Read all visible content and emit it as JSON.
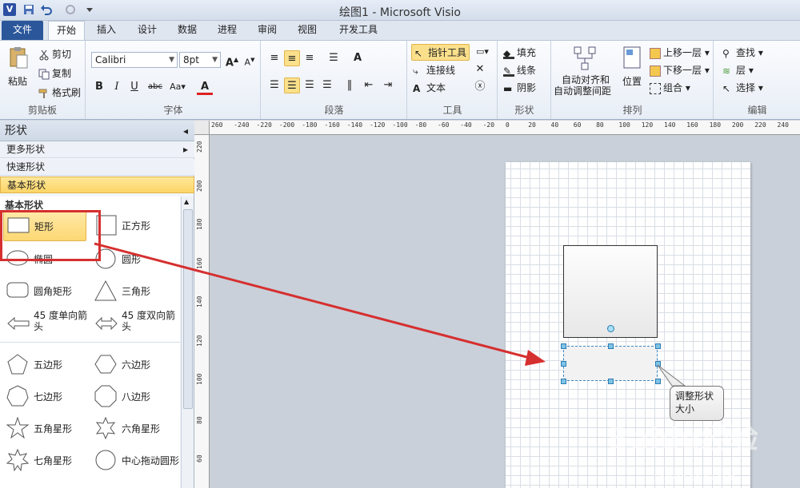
{
  "window": {
    "title": "绘图1 - Microsoft Visio"
  },
  "tabs": [
    "文件",
    "开始",
    "插入",
    "设计",
    "数据",
    "进程",
    "审阅",
    "视图",
    "开发工具"
  ],
  "ribbon": {
    "clipboard": {
      "paste": "粘贴",
      "cut": "剪切",
      "copy": "复制",
      "format_painter": "格式刷",
      "label": "剪贴板"
    },
    "font": {
      "family": "Calibri",
      "size": "8pt",
      "label": "字体"
    },
    "paragraph": {
      "label": "段落"
    },
    "tools": {
      "pointer": "指针工具",
      "connector": "连接线",
      "text": "文本",
      "label": "工具"
    },
    "shape": {
      "fill": "填充",
      "line": "线条",
      "shadow": "阴影",
      "label": "形状"
    },
    "arrange": {
      "auto_align": "自动对齐和\n自动调整间距",
      "auto_align_l1": "自动对齐和",
      "auto_align_l2": "自动调整间距",
      "position": "位置",
      "bring_forward": "上移一层",
      "send_backward": "下移一层",
      "group": "组合",
      "label": "排列"
    },
    "editing": {
      "find": "查找",
      "layer": "层",
      "select": "选择",
      "label": "编辑"
    }
  },
  "shapes_panel": {
    "title": "形状",
    "more_shapes": "更多形状",
    "quick_shapes": "快速形状",
    "basic_shapes": "基本形状",
    "stencil_title": "基本形状",
    "masters": [
      {
        "name": "矩形"
      },
      {
        "name": "正方形"
      },
      {
        "name": "椭圆"
      },
      {
        "name": "圆形"
      },
      {
        "name": "圆角矩形"
      },
      {
        "name": "三角形"
      },
      {
        "name": "45 度单向箭头"
      },
      {
        "name": "45 度双向箭头"
      },
      {
        "name": "五边形"
      },
      {
        "name": "六边形"
      },
      {
        "name": "七边形"
      },
      {
        "name": "八边形"
      },
      {
        "name": "五角星形"
      },
      {
        "name": "六角星形"
      },
      {
        "name": "七角星形"
      },
      {
        "name": "中心拖动圆形"
      }
    ]
  },
  "ruler": {
    "h_ticks": [
      "260",
      "-240",
      "-220",
      "-200",
      "-180",
      "-160",
      "-140",
      "-120",
      "-100",
      "-80",
      "-60",
      "-40",
      "-20",
      "0",
      "20",
      "40",
      "60",
      "80",
      "100",
      "120",
      "140",
      "160",
      "180",
      "200",
      "220",
      "240"
    ],
    "v_ticks": [
      "220",
      "200",
      "180",
      "160",
      "140",
      "120",
      "100",
      "80",
      "60"
    ]
  },
  "canvas": {
    "tooltip": "调整形状大小"
  },
  "watermark": {
    "brand": "Baidu经验",
    "url": "jingyan.baidu.com"
  },
  "colors": {
    "accent": "#2b579a",
    "highlight": "#d62f2f",
    "selection": "#3b87c4",
    "active": "#fbe08c"
  }
}
